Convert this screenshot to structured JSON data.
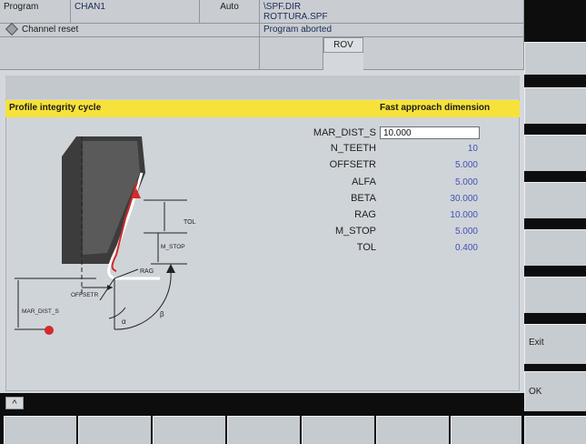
{
  "header": {
    "mode_label": "Program",
    "channel": "CHAN1",
    "op_mode": "Auto",
    "program_path_dir": "\\SPF.DIR",
    "program_path_file": "ROTTURA.SPF",
    "channel_status": "Channel reset",
    "program_status": "Program aborted",
    "override_indicator": "ROV"
  },
  "banner": {
    "left_title": "Profile integrity cycle",
    "right_title": "Fast approach dimension"
  },
  "parameters": [
    {
      "label": "MAR_DIST_S",
      "value": "10.000"
    },
    {
      "label": "N_TEETH",
      "value": "10"
    },
    {
      "label": "OFFSETR",
      "value": "5.000"
    },
    {
      "label": "ALFA",
      "value": "5.000"
    },
    {
      "label": "BETA",
      "value": "30.000"
    },
    {
      "label": "RAG",
      "value": "10.000"
    },
    {
      "label": "M_STOP",
      "value": "5.000"
    },
    {
      "label": "TOL",
      "value": "0.400"
    }
  ],
  "diagram": {
    "tol_label": "TOL",
    "mstop_label": "M_STOP",
    "rag_label": "RAG",
    "offsetr_label": "OFFSETR",
    "mardist_label": "MAR_DIST_S",
    "alpha_label": "α",
    "beta_label": "β"
  },
  "softkeys_vertical": [
    "",
    "",
    "",
    "",
    "",
    "",
    "",
    "Exit",
    "OK"
  ],
  "bottom": {
    "recall_icon": "^"
  },
  "colors": {
    "banner": "#f6e23a",
    "value_text": "#4050b6",
    "marker": "#d32a2a"
  }
}
